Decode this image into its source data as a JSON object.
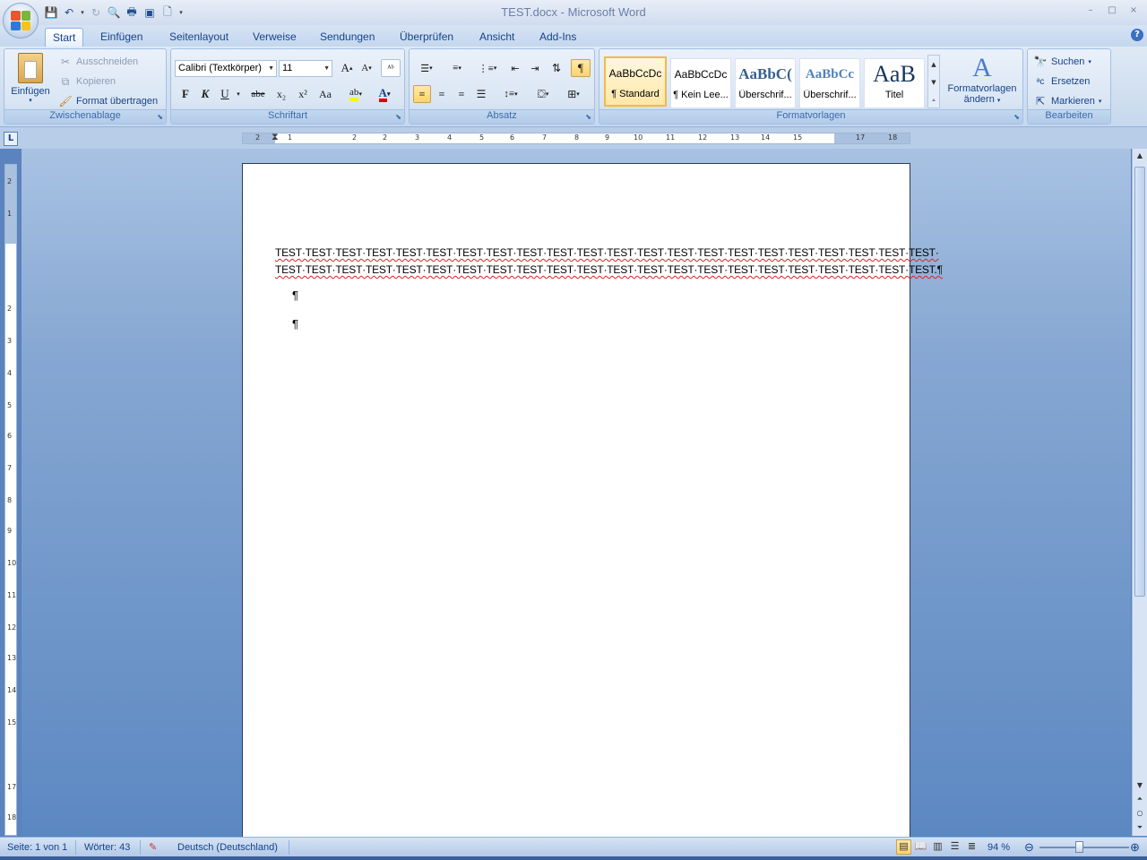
{
  "window": {
    "title": "TEST.docx - Microsoft Word",
    "controls": [
      "–",
      "□",
      "×"
    ]
  },
  "qat": [
    "save-icon",
    "undo-icon",
    "redo-icon",
    "print-preview-icon",
    "print-icon",
    "fullscreen-icon",
    "new-doc-icon",
    "customize-icon"
  ],
  "tabs": [
    {
      "label": "Start",
      "active": true
    },
    {
      "label": "Einfügen"
    },
    {
      "label": "Seitenlayout"
    },
    {
      "label": "Verweise"
    },
    {
      "label": "Sendungen"
    },
    {
      "label": "Überprüfen"
    },
    {
      "label": "Ansicht"
    },
    {
      "label": "Add-Ins"
    }
  ],
  "clipboard": {
    "group_label": "Zwischenablage",
    "paste": "Einfügen",
    "cut": "Ausschneiden",
    "copy": "Kopieren",
    "format_painter": "Format übertragen"
  },
  "font": {
    "group_label": "Schriftart",
    "family": "Calibri (Textkörper)",
    "size": "11",
    "bold": "F",
    "italic": "K",
    "underline": "U",
    "strike": "abe",
    "sub": "x₂",
    "sup": "x²",
    "case": "Aa"
  },
  "paragraph": {
    "group_label": "Absatz"
  },
  "styles": {
    "group_label": "Formatvorlagen",
    "items": [
      {
        "preview": "AaBbCcDc",
        "name": "¶ Standard"
      },
      {
        "preview": "AaBbCcDc",
        "name": "¶ Kein Lee..."
      },
      {
        "preview": "AaBbC(",
        "name": "Überschrif..."
      },
      {
        "preview": "AaBbCc",
        "name": "Überschrif..."
      },
      {
        "preview": "AaB",
        "name": "Titel"
      }
    ],
    "change_label_1": "Formatvorlagen",
    "change_label_2": "ändern"
  },
  "editing": {
    "group_label": "Bearbeiten",
    "find": "Suchen",
    "replace": "Ersetzen",
    "select": "Markieren"
  },
  "document": {
    "line1": "TEST·TEST·TEST·TEST·TEST·TEST·TEST·TEST·TEST·TEST·TEST·TEST·TEST·TEST·TEST·TEST·TEST·TEST·TEST·TEST·TEST·TEST·",
    "line2": "TEST·TEST·TEST·TEST·TEST·TEST·TEST·TEST·TEST·TEST·TEST·TEST·TEST·TEST·TEST·TEST·TEST·TEST·TEST·TEST·TEST·TEST.¶",
    "pilcrow": "¶"
  },
  "ruler": {
    "h_numbers": [
      "2",
      "1",
      "1",
      "2",
      "3",
      "4",
      "5",
      "6",
      "7",
      "8",
      "9",
      "10",
      "11",
      "12",
      "13",
      "14",
      "15",
      "17",
      "18"
    ]
  },
  "status": {
    "page": "Seite: 1 von 1",
    "words": "Wörter: 43",
    "language": "Deutsch (Deutschland)",
    "zoom": "94 %"
  },
  "colors": {
    "accent": "#15428b",
    "highlight": "#ffd36a"
  }
}
